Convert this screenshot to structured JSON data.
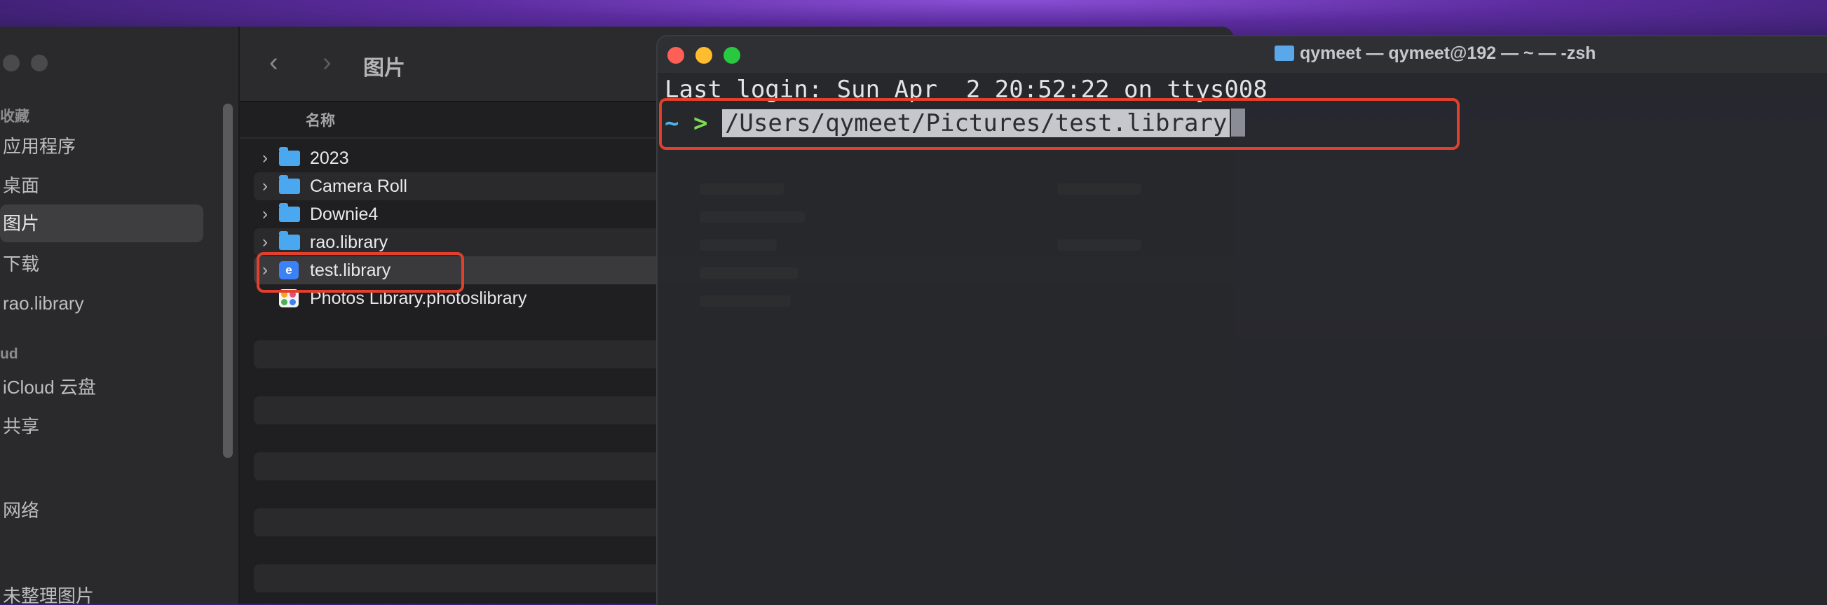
{
  "finder": {
    "title": "图片",
    "column_name": "名称",
    "sidebar": {
      "sections": [
        "收藏",
        "ud"
      ],
      "items": [
        {
          "label": "应用程序"
        },
        {
          "label": "桌面"
        },
        {
          "label": "图片",
          "selected": true
        },
        {
          "label": "下载"
        },
        {
          "label": "rao.library"
        },
        {
          "label": "iCloud 云盘"
        },
        {
          "label": "共享"
        },
        {
          "label": "网络"
        },
        {
          "label": "未整理图片"
        }
      ]
    },
    "rows": [
      {
        "name": "2023",
        "icon": "folder-icon",
        "expandable": true
      },
      {
        "name": "Camera Roll",
        "icon": "folder-icon",
        "expandable": true
      },
      {
        "name": "Downie4",
        "icon": "folder-icon",
        "expandable": true
      },
      {
        "name": "rao.library",
        "icon": "folder-icon",
        "expandable": true
      },
      {
        "name": "test.library",
        "icon": "library-icon",
        "expandable": true,
        "selected": true
      },
      {
        "name": "Photos Library.photoslibrary",
        "icon": "photos-library-icon",
        "expandable": false
      }
    ]
  },
  "terminal": {
    "title": "qymeet — qymeet@192 — ~ — -zsh",
    "last_login": "Last login: Sun Apr  2 20:52:22 on ttys008",
    "prompt_tilde": "~",
    "prompt_arrow": ">",
    "command": "/Users/qymeet/Pictures/test.library"
  },
  "colors": {
    "highlight_box": "#e0402c",
    "prompt_tilde": "#4fb3f0",
    "prompt_arrow": "#7ed957",
    "folder": "#4aa8f0"
  }
}
